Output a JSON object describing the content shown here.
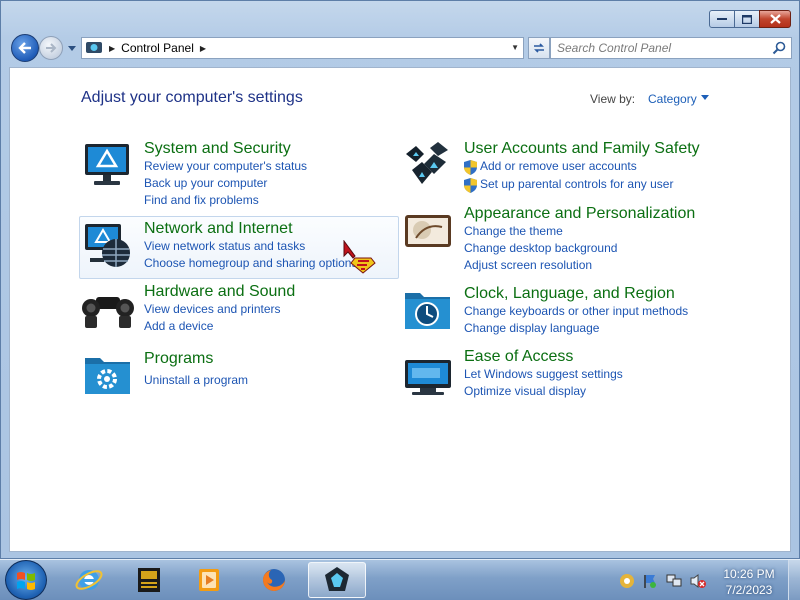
{
  "address": {
    "breadcrumb": "Control Panel",
    "search_placeholder": "Search Control Panel"
  },
  "main": {
    "title": "Adjust your computer's settings",
    "view_by_label": "View by:",
    "view_by_value": "Category"
  },
  "categories": [
    {
      "title": "System and Security",
      "links": [
        "Review your computer's status",
        "Back up your computer",
        "Find and fix problems"
      ]
    },
    {
      "title": "Network and Internet",
      "links": [
        "View network status and tasks",
        "Choose homegroup and sharing options"
      ]
    },
    {
      "title": "Hardware and Sound",
      "links": [
        "View devices and printers",
        "Add a device"
      ]
    },
    {
      "title": "Programs",
      "links": [
        "Uninstall a program"
      ]
    },
    {
      "title": "User Accounts and Family Safety",
      "links": [
        "Add or remove user accounts",
        "Set up parental controls for any user"
      ]
    },
    {
      "title": "Appearance and Personalization",
      "links": [
        "Change the theme",
        "Change desktop background",
        "Adjust screen resolution"
      ]
    },
    {
      "title": "Clock, Language, and Region",
      "links": [
        "Change keyboards or other input methods",
        "Change display language"
      ]
    },
    {
      "title": "Ease of Access",
      "links": [
        "Let Windows suggest settings",
        "Optimize visual display"
      ]
    }
  ],
  "taskbar": {
    "clock_time": "10:26 PM",
    "clock_date": "7/2/2023"
  },
  "colors": {
    "title_blue": "#1e3287",
    "category_green": "#0b6f12",
    "link_blue": "#1d55b3"
  }
}
